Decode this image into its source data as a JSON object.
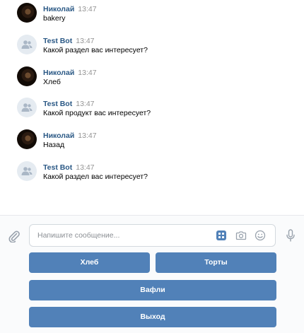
{
  "messages": [
    {
      "author": "Николай",
      "time": "13:47",
      "text": "bakery",
      "avatar": "user-photo"
    },
    {
      "author": "Test Bot",
      "time": "13:47",
      "text": "Какой раздел вас интересует?",
      "avatar": "bot-icon"
    },
    {
      "author": "Николай",
      "time": "13:47",
      "text": "Хлеб",
      "avatar": "user-photo"
    },
    {
      "author": "Test Bot",
      "time": "13:47",
      "text": "Какой продукт вас интересует?",
      "avatar": "bot-icon"
    },
    {
      "author": "Николай",
      "time": "13:47",
      "text": "Назад",
      "avatar": "user-photo"
    },
    {
      "author": "Test Bot",
      "time": "13:47",
      "text": "Какой раздел вас интересует?",
      "avatar": "bot-icon"
    }
  ],
  "composer": {
    "placeholder": "Напишите сообщение...",
    "icons": [
      "paperclip-icon",
      "keyboard-icon",
      "camera-icon",
      "smile-icon",
      "microphone-icon"
    ]
  },
  "keyboard": {
    "buttons": [
      "Хлеб",
      "Торты",
      "Вафли",
      "Выход"
    ]
  },
  "colors": {
    "link": "#2a5885",
    "button": "#5181b8",
    "time": "#939393"
  }
}
